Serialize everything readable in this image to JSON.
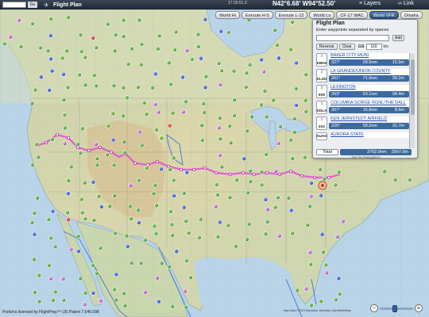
{
  "topbar": {
    "go_label": "Go",
    "app_title": "Flight Plan",
    "clock": "17:25:51 Z",
    "coordinates": "N42°6.68' W94°52.50'",
    "layers_label": "Layers",
    "link_label": "Link"
  },
  "chart_tabs": [
    {
      "label": "World Hi",
      "active": false
    },
    {
      "label": "Enroute H-5",
      "active": false
    },
    {
      "label": "Enroute L-12",
      "active": false
    },
    {
      "label": "World Lo",
      "active": false
    },
    {
      "label": "CF-17 WAC",
      "active": false
    },
    {
      "label": "World VFR",
      "active": true
    },
    {
      "label": "Omaha",
      "active": false
    }
  ],
  "flight_plan": {
    "title": "Flight Plan",
    "instructions": "Enter waypoints separated by spaces",
    "add_label": "Add",
    "reverse_label": "Reverse",
    "clear_label": "Clear",
    "gs_label": "GS",
    "gs_value": "110",
    "gs_unit": "kts",
    "waypoints": [
      {
        "id": "KBKE",
        "name": "BAKER CITY MUNI",
        "heading": "327°",
        "distance": "28.5nm",
        "time": "15.5m"
      },
      {
        "id": "KLGD",
        "name": "LA GRANDE/UNION COUNTY",
        "heading": "261°",
        "distance": "71.9nm",
        "time": "39.2m"
      },
      {
        "id": "9S9",
        "name": "LEXINGTON",
        "heading": "263°",
        "distance": "63.1nm",
        "time": "34.4m"
      },
      {
        "id": "KDLS",
        "name": "COLUMBIA GORGE RGNL/THE DALL",
        "heading": "267°",
        "distance": "15.8nm",
        "time": "8.6m"
      },
      {
        "id": "4S2",
        "name": "KEN JERNSTEDT AIRFIELD",
        "heading": "225°",
        "distance": "58.2nm",
        "time": "31.7m"
      },
      {
        "id": "KUAO",
        "name": "AURORA STATE",
        "heading": "",
        "distance": "",
        "time": ""
      }
    ],
    "total_label": "Total",
    "total_distance": "2762.9nm",
    "total_time": "25h7.0m",
    "note": "Not for Navigation"
  },
  "footer": {
    "license": "Portions licensed by FlightPrep™ US Patent 7,640,098",
    "attribution": "Map Data ©2013 SkyVector, AeroNav, OpenStreetMap",
    "zoom_level": 0.45
  },
  "colors": {
    "route": "#e24bd6",
    "airport_green": "#3a9f2c",
    "airport_blue": "#2850c8",
    "airport_red": "#d02020",
    "airport_magenta": "#b050c0",
    "ocean": "#b9d3e8",
    "active_tab": "#3d6a9d"
  }
}
